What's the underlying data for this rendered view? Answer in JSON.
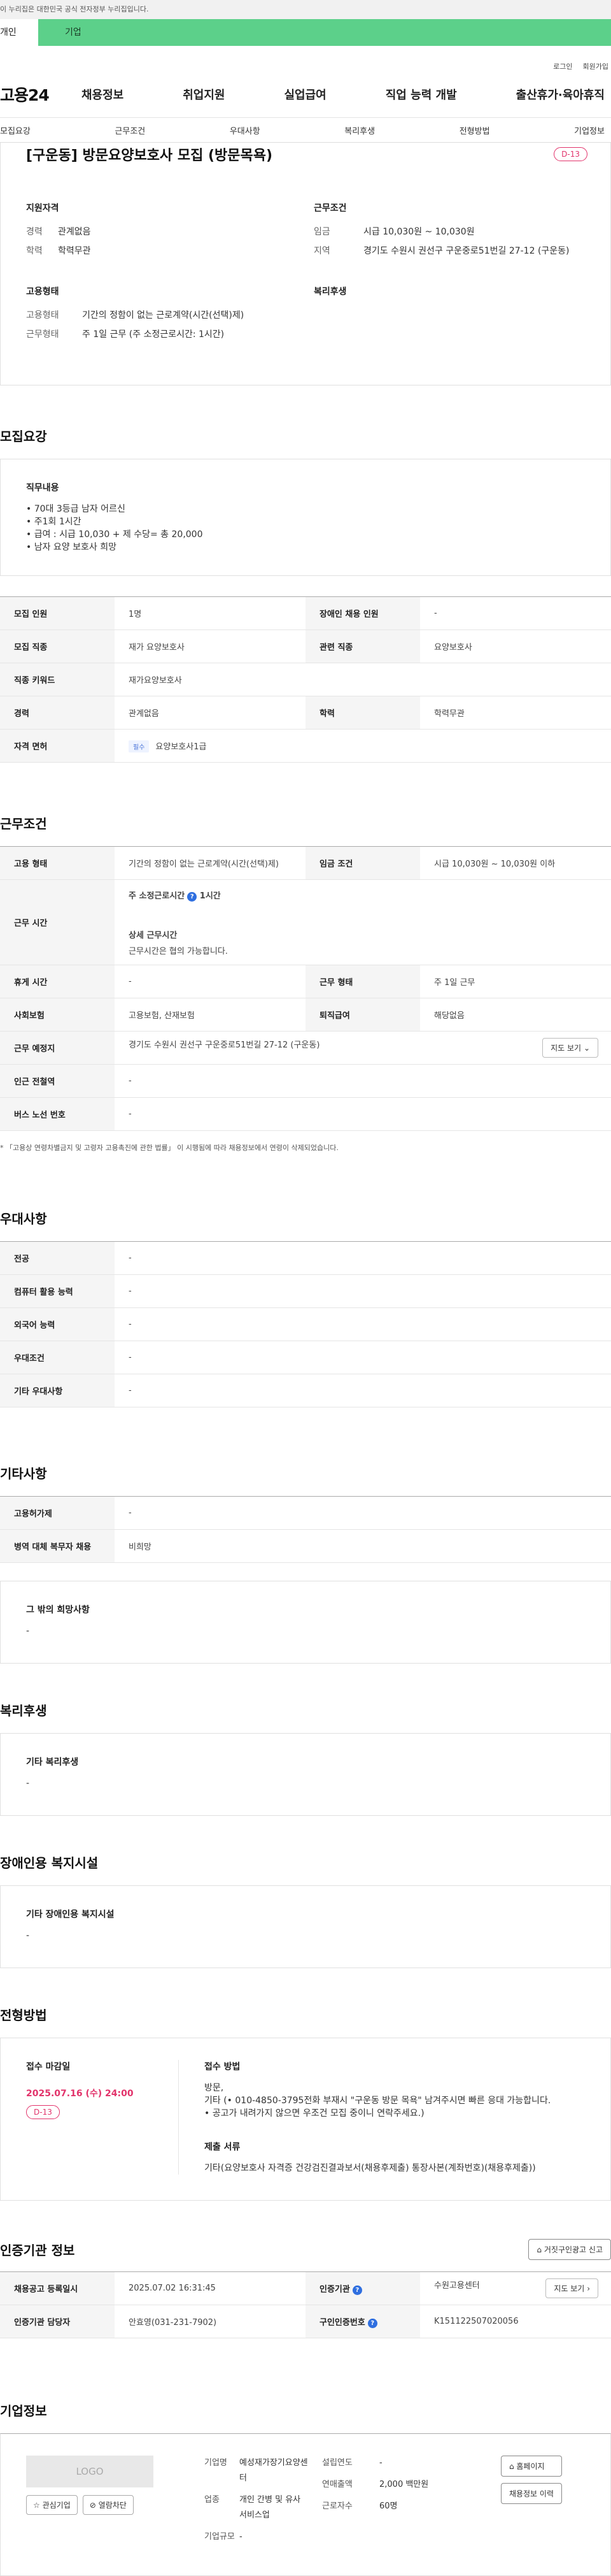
{
  "gov_bar": "이 누리집은 대한민국 공식 전자정부 누리집입니다.",
  "audience_tabs": [
    "개인",
    "기업"
  ],
  "util": [
    "로그인",
    "회원가입"
  ],
  "logo": "고용24",
  "gnb": [
    "채용정보",
    "취업지원",
    "실업급여",
    "직업 능력 개발",
    "출산휴가·육아휴직"
  ],
  "section_nav": [
    "모집요강",
    "근무조건",
    "우대사항",
    "복리후생",
    "전형방법",
    "기업정보"
  ],
  "summary": {
    "title": "[구운동] 방문요양보호사 모집 (방문목욕)",
    "dday": "D-13",
    "qual_title": "지원자격",
    "qual": [
      {
        "k": "경력",
        "v": "관계없음"
      },
      {
        "k": "학력",
        "v": "학력무관"
      }
    ],
    "cond_title": "근무조건",
    "cond": [
      {
        "k": "임금",
        "v": "시급 10,030원 ~ 10,030원"
      },
      {
        "k": "지역",
        "v": "경기도 수원시 권선구 구운중로51번길 27-12 (구운동)"
      }
    ],
    "emp_title": "고용형태",
    "emp": [
      {
        "k": "고용형태",
        "v": "기간의 정함이 없는 근로계약(시간(선택)제)"
      },
      {
        "k": "근무형태",
        "v": "주 1일 근무 (주 소정근로시간: 1시간)"
      }
    ],
    "welfare_title": "복리후생"
  },
  "recruit": {
    "title": "모집요강",
    "duty_title": "직무내용",
    "duty_lines": [
      "• 70대 3등급 남자 어르신",
      "• 주1회 1시간",
      "• 급여 : 시급 10,030 + 제 수당= 총 20,000",
      "• 남자 요양 보호사 희망"
    ],
    "table": {
      "headcount_k": "모집 인원",
      "headcount_v": "1명",
      "disabled_k": "장애인 채용 인원",
      "disabled_v": "-",
      "job_k": "모집 직종",
      "job_v": "재가 요양보호사",
      "related_k": "관련 직종",
      "related_v": "요양보호사",
      "keyword_k": "직종 키워드",
      "keyword_v": "재가요양보호사",
      "career_k": "경력",
      "career_v": "관계없음",
      "edu_k": "학력",
      "edu_v": "학력무관",
      "license_k": "자격 면허",
      "license_tag": "필수",
      "license_v": "요양보호사1급"
    }
  },
  "work": {
    "title": "근무조건",
    "emp_k": "고용 형태",
    "emp_v": "기간의 정함이 없는 근로계약(시간(선택)제)",
    "wage_k": "임금 조건",
    "wage_v": "시급 10,030원 ~ 10,030원 이하",
    "hours_k": "근무 시간",
    "hours_sub1": "주 소정근로시간",
    "hours_val1": "1시간",
    "hours_sub2": "상세 근무시간",
    "hours_val2": "근무시간은 협의 가능합니다.",
    "rest_k": "휴게 시간",
    "rest_v": "-",
    "form_k": "근무 형태",
    "form_v": "주 1일 근무",
    "insurance_k": "사회보험",
    "insurance_v": "고용보험, 산재보험",
    "retire_k": "퇴직급여",
    "retire_v": "해당없음",
    "place_k": "근무 예정지",
    "place_v": "경기도 수원시 권선구 구운중로51번길 27-12 (구운동)",
    "map_btn": "지도 보기",
    "subway_k": "인근 전철역",
    "subway_v": "-",
    "bus_k": "버스 노선 번호",
    "bus_v": "-",
    "note": "* 「고용상 연령차별금지 및 고령자 고용촉진에 관한 법률」 이 시행됨에 따라 채용정보에서 연령이 삭제되었습니다."
  },
  "pref": {
    "title": "우대사항",
    "rows": [
      {
        "k": "전공",
        "v": "-"
      },
      {
        "k": "컴퓨터 활용 능력",
        "v": "-"
      },
      {
        "k": "외국어 능력",
        "v": "-"
      },
      {
        "k": "우대조건",
        "v": "-"
      },
      {
        "k": "기타 우대사항",
        "v": "-"
      }
    ]
  },
  "etc": {
    "title": "기타사항",
    "rows": [
      {
        "k": "고용허가제",
        "v": "-"
      },
      {
        "k": "병역 대체 복무자 채용",
        "v": "비희망"
      }
    ],
    "box_title": "그 밖의 희망사항",
    "box_v": "-"
  },
  "welfare": {
    "title": "복리후생",
    "box_title": "기타 복리후생",
    "box_v": "-"
  },
  "disabled": {
    "title": "장애인용 복지시설",
    "box_title": "기타 장애인용 복지시설",
    "box_v": "-"
  },
  "method": {
    "title": "전형방법",
    "deadline_title": "접수 마감일",
    "deadline": "2025.07.16 (수) 24:00",
    "dday": "D-13",
    "apply_title": "접수 방법",
    "apply_lines": [
      "방문,",
      "기타 (• 010-4850-3795전화 부재시 \"구운동 방문 목욕\" 남겨주시면 빠른 응대 가능합니다.",
      "• 공고가 내려가지 않으면 우조건 모집 중이니 연락주세요.)"
    ],
    "docs_title": "제출 서류",
    "docs_v": "기타(요양보호사 자격증 건강검진결과보서(채용후제출) 통장사본(계좌번호)(채용후제출))"
  },
  "cert": {
    "title": "인증기관 정보",
    "report_btn": "거짓구인광고 신고",
    "reg_k": "채용공고 등록일시",
    "reg_v": "2025.07.02 16:31:45",
    "org_k": "인증기관",
    "org_v": "수원고용센터",
    "map_btn": "지도 보기",
    "mgr_k": "인증기관 담당자",
    "mgr_v": "안효영(031-231-7902)",
    "no_k": "구인인증번호",
    "no_v": "K151122507020056"
  },
  "company": {
    "title": "기업정보",
    "logo": "LOGO",
    "btn_fav": "관심기업",
    "btn_block": "열람차단",
    "name_k": "기업명",
    "name_v": "예성재가장기요양센터",
    "biz_k": "업종",
    "biz_v": "개인 간병 및 유사 서비스업",
    "size_k": "기업규모",
    "size_v": "-",
    "year_k": "설립연도",
    "year_v": "-",
    "sales_k": "연매출액",
    "sales_v": "2,000 백만원",
    "emp_k": "근로자수",
    "emp_v": "60명",
    "home_btn": "홈페이지",
    "history_btn": "채용정보 이력"
  }
}
